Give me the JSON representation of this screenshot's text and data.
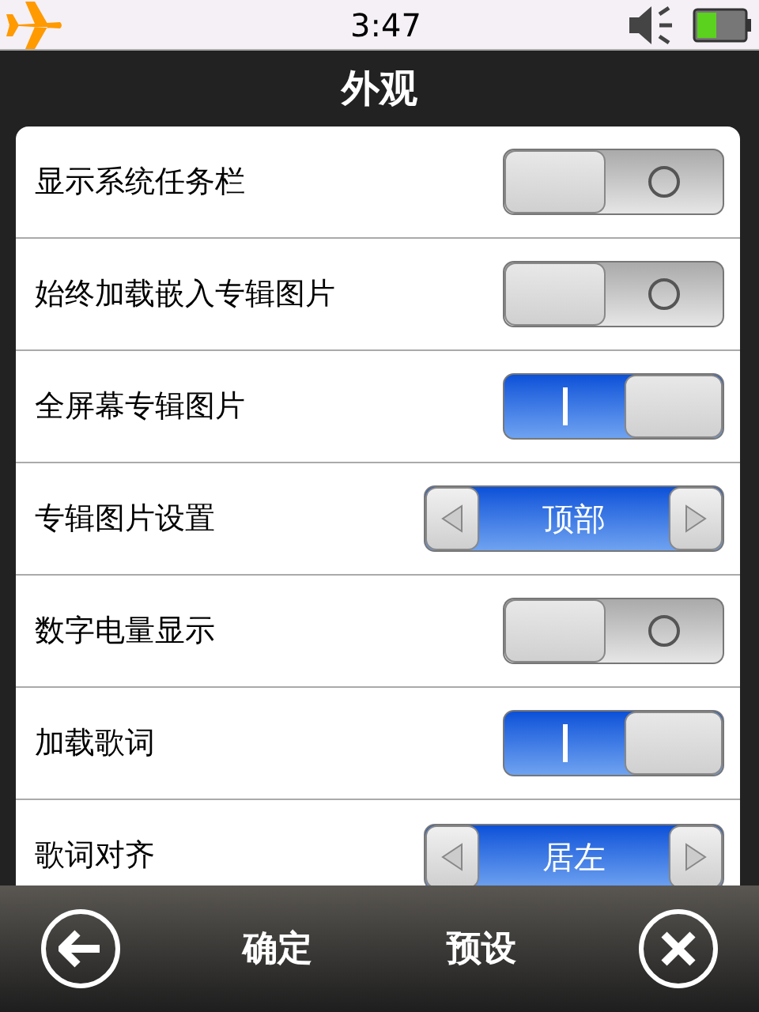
{
  "status_bar": {
    "time": "3:47"
  },
  "title": "外观",
  "settings": [
    {
      "label": "显示系统任务栏",
      "kind": "toggle",
      "on": false
    },
    {
      "label": "始终加载嵌入专辑图片",
      "kind": "toggle",
      "on": false
    },
    {
      "label": "全屏幕专辑图片",
      "kind": "toggle",
      "on": true
    },
    {
      "label": "专辑图片设置",
      "kind": "selector",
      "value": "顶部"
    },
    {
      "label": "数字电量显示",
      "kind": "toggle",
      "on": false
    },
    {
      "label": "加载歌词",
      "kind": "toggle",
      "on": true
    },
    {
      "label": "歌词对齐",
      "kind": "selector",
      "value": "居左"
    }
  ],
  "bottom_bar": {
    "buttons": [
      "确定",
      "预设"
    ]
  }
}
